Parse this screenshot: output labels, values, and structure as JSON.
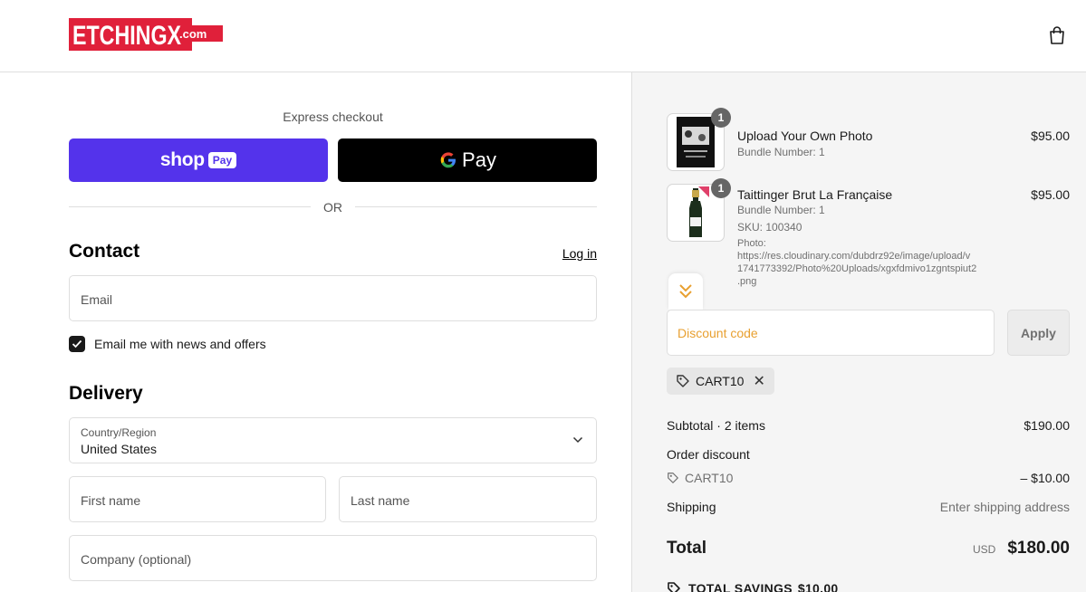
{
  "header": {
    "logo_text": "ETCHINGX",
    "logo_suffix": ".com",
    "cart_icon": "shopping-bag-icon"
  },
  "express": {
    "label": "Express checkout",
    "shop_pay_word": "shop",
    "shop_pay_badge": "Pay",
    "gpay_word": "Pay",
    "or_text": "OR"
  },
  "contact": {
    "title": "Contact",
    "login_link": "Log in",
    "email_placeholder": "Email",
    "newsletter_label": "Email me with news and offers",
    "newsletter_checked": true
  },
  "delivery": {
    "title": "Delivery",
    "country_label": "Country/Region",
    "country_value": "United States",
    "first_name_placeholder": "First name",
    "last_name_placeholder": "Last name",
    "company_placeholder": "Company (optional)"
  },
  "order": {
    "items": [
      {
        "name": "Upload Your Own Photo",
        "qty": "1",
        "meta1": "Bundle Number: 1",
        "price": "$95.00"
      },
      {
        "name": "Taittinger Brut La Française",
        "qty": "1",
        "meta1": "Bundle Number: 1",
        "meta2": "SKU: 100340",
        "meta3": "Photo:",
        "meta4": "https://res.cloudinary.com/dubdrz92e/image/upload/v",
        "meta5": "1741773392/Photo%20Uploads/xgxfdmivo1zgntspiut2",
        "meta6": ".png",
        "price": "$95.00"
      }
    ],
    "discount_placeholder": "Discount code",
    "apply_label": "Apply",
    "applied_code": "CART10",
    "subtotal_label": "Subtotal · 2 items",
    "subtotal_value": "$190.00",
    "order_discount_label": "Order discount",
    "discount_code": "CART10",
    "discount_value": "– $10.00",
    "shipping_label": "Shipping",
    "shipping_value": "Enter shipping address",
    "total_label": "Total",
    "total_currency": "USD",
    "total_value": "$180.00",
    "savings_label": "TOTAL SAVINGS",
    "savings_value": "$10.00"
  },
  "colors": {
    "shop_pay": "#5433eb",
    "logo_red": "#e0203a",
    "discount_placeholder": "#e8a030"
  }
}
